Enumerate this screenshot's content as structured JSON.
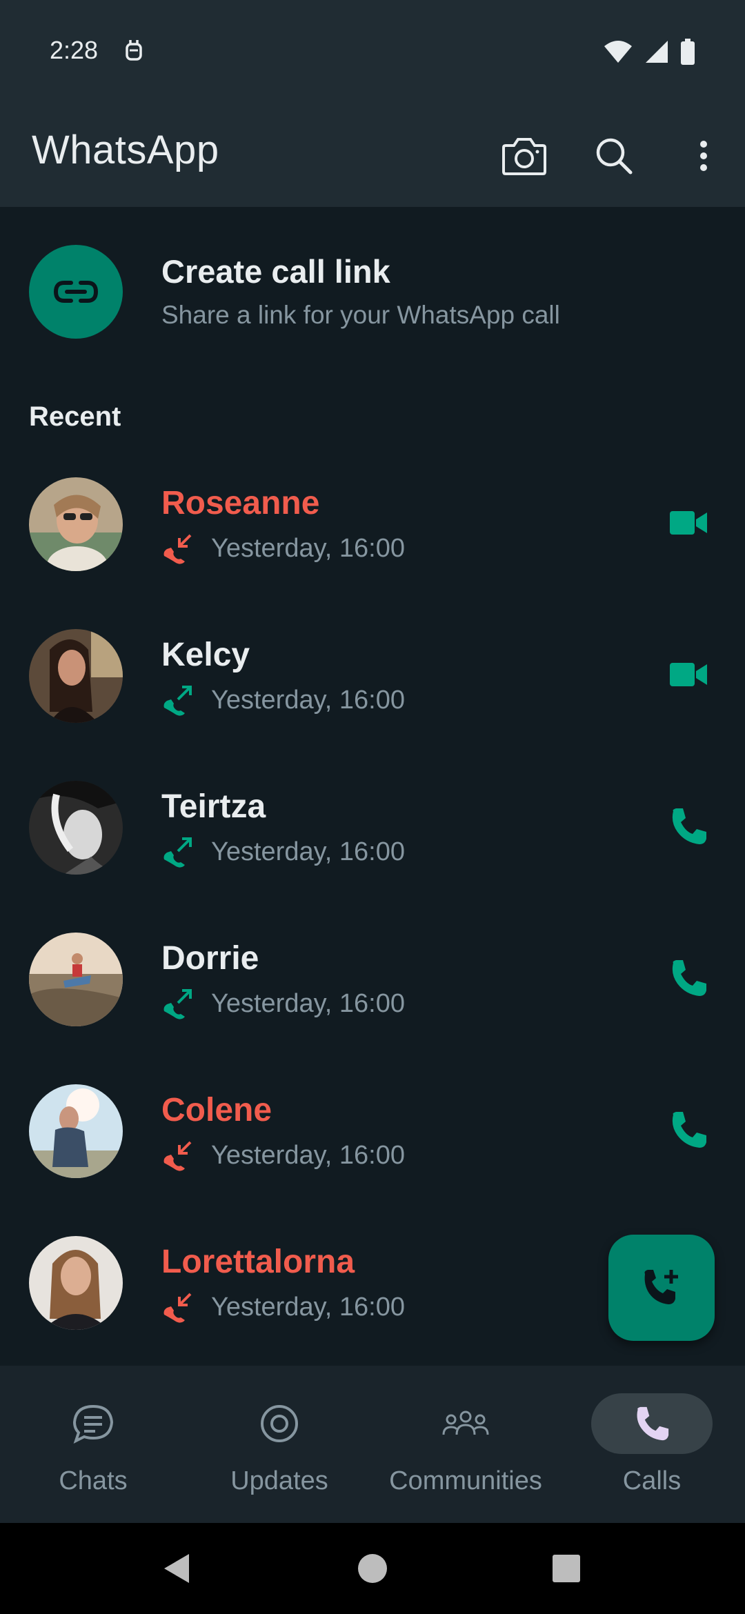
{
  "status_bar": {
    "time": "2:28",
    "icons": [
      "notification-icon",
      "wifi-icon",
      "signal-icon",
      "battery-icon"
    ]
  },
  "app_bar": {
    "title": "WhatsApp",
    "actions": [
      "camera-icon",
      "search-icon",
      "more-vert-icon"
    ]
  },
  "call_link": {
    "title": "Create call link",
    "subtitle": "Share a link for your WhatsApp call",
    "icon": "link-icon"
  },
  "section_label": "Recent",
  "calls": [
    {
      "name": "Roseanne",
      "time": "Yesterday, 16:00",
      "direction": "missed-incoming",
      "type": "video"
    },
    {
      "name": "Kelcy",
      "time": "Yesterday, 16:00",
      "direction": "outgoing",
      "type": "video"
    },
    {
      "name": "Teirtza",
      "time": "Yesterday, 16:00",
      "direction": "outgoing",
      "type": "voice"
    },
    {
      "name": "Dorrie",
      "time": "Yesterday, 16:00",
      "direction": "outgoing",
      "type": "voice"
    },
    {
      "name": "Colene",
      "time": "Yesterday, 16:00",
      "direction": "missed-incoming",
      "type": "voice"
    },
    {
      "name": "Lorettalorna",
      "time": "Yesterday, 16:00",
      "direction": "missed-incoming",
      "type": "voice"
    }
  ],
  "bottom_nav": {
    "items": [
      {
        "label": "Chats",
        "icon": "chat-icon",
        "active": false
      },
      {
        "label": "Updates",
        "icon": "updates-icon",
        "active": false
      },
      {
        "label": "Communities",
        "icon": "communities-icon",
        "active": false
      },
      {
        "label": "Calls",
        "icon": "phone-icon",
        "active": true
      }
    ]
  },
  "colors": {
    "accent": "#00826a",
    "missed": "#f15c4d",
    "background": "#111b21",
    "bar": "#202c33",
    "secondary_text": "#8696a0"
  }
}
